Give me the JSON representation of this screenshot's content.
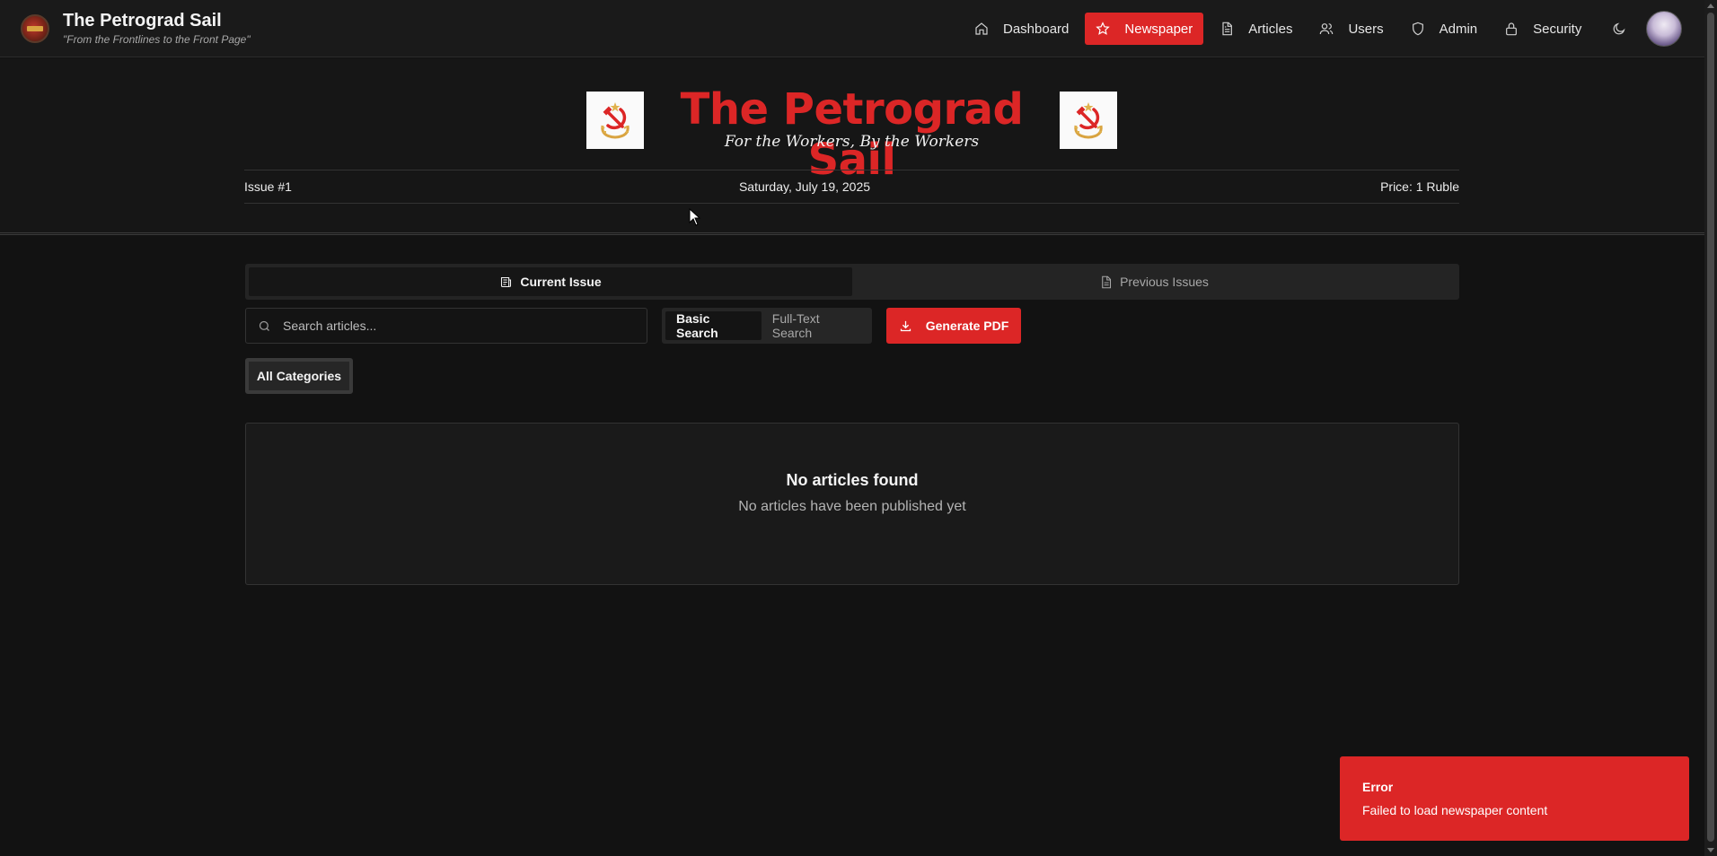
{
  "brand": {
    "title": "The Petrograd Sail",
    "motto": "\"From the Frontlines to the Front Page\""
  },
  "nav": {
    "items": [
      {
        "label": "Dashboard",
        "icon": "home-icon"
      },
      {
        "label": "Newspaper",
        "icon": "star-icon",
        "active": true
      },
      {
        "label": "Articles",
        "icon": "document-icon"
      },
      {
        "label": "Users",
        "icon": "users-icon"
      },
      {
        "label": "Admin",
        "icon": "shield-icon"
      },
      {
        "label": "Security",
        "icon": "lock-icon"
      }
    ],
    "theme_toggle_icon": "moon-icon"
  },
  "masthead": {
    "title": "The Petrograd Sail",
    "subtitle": "For the Workers, By the Workers",
    "issue": "Issue #1",
    "date": "Saturday, July 19, 2025",
    "price": "Price: 1 Ruble"
  },
  "tabs": {
    "current": "Current Issue",
    "previous": "Previous Issues"
  },
  "search": {
    "placeholder": "Search articles...",
    "value": "",
    "modes": [
      "Basic Search",
      "Full-Text Search"
    ],
    "active_mode": "Basic Search"
  },
  "actions": {
    "generate_pdf": "Generate PDF"
  },
  "filters": {
    "category": "All Categories"
  },
  "empty_state": {
    "title": "No articles found",
    "message": "No articles have been published yet"
  },
  "toast": {
    "title": "Error",
    "message": "Failed to load newspaper content"
  },
  "colors": {
    "accent": "#dc2626",
    "background": "#121212",
    "surface": "#1a1a1a"
  }
}
